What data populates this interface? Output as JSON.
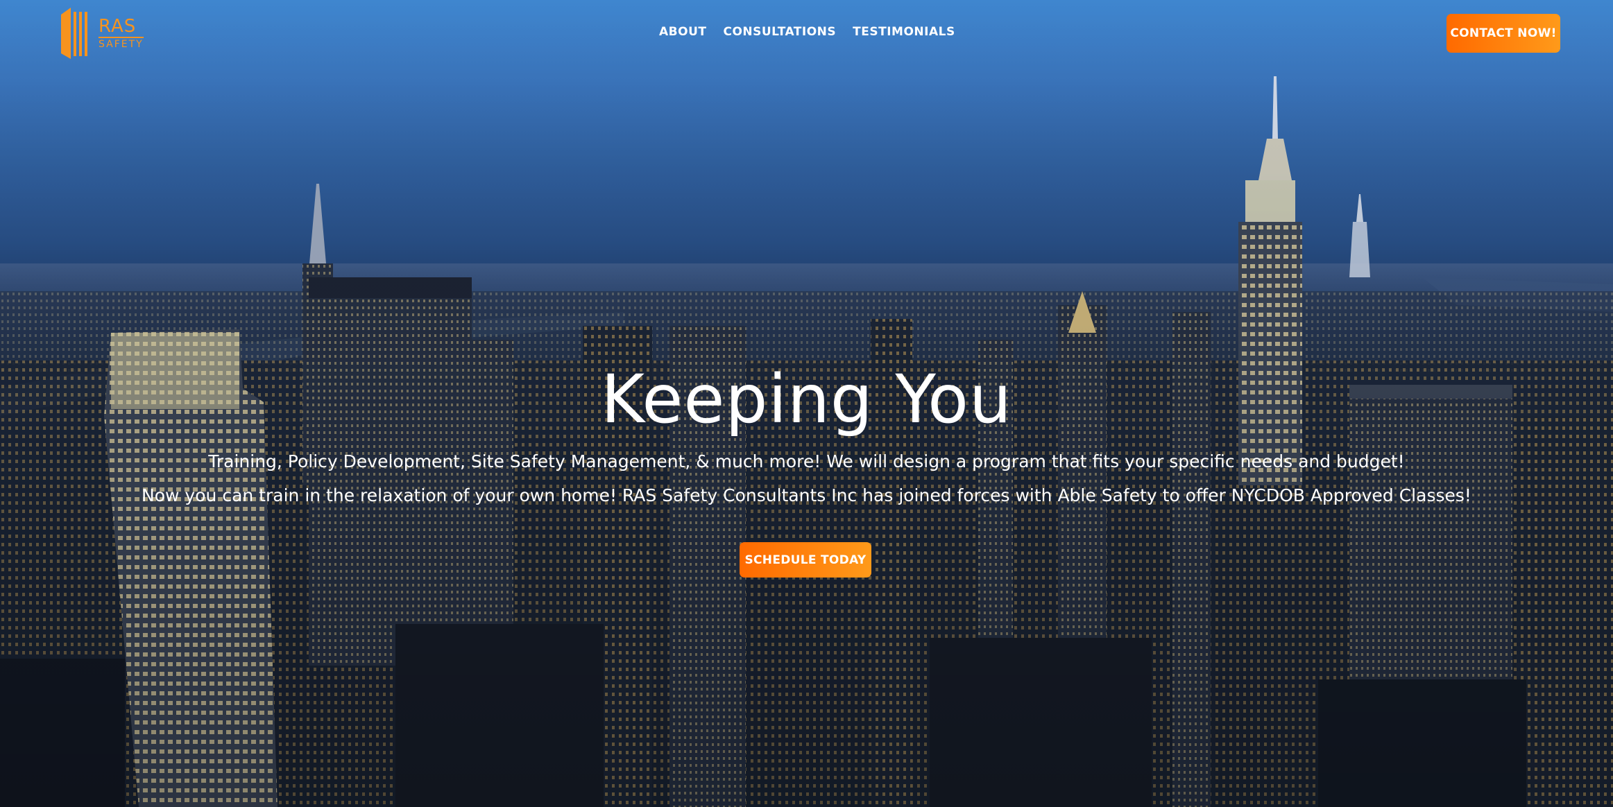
{
  "brand": {
    "logo_icon": "ras-safety-logo-icon",
    "name_top": "RAS",
    "name_bottom": "SAFETY",
    "accent_color": "#f7931e"
  },
  "nav": {
    "items": [
      {
        "label": "ABOUT"
      },
      {
        "label": "CONSULTATIONS"
      },
      {
        "label": "TESTIMONIALS"
      }
    ]
  },
  "header": {
    "cta_label": "CONTACT NOW!",
    "cta_color": "#ff7a00"
  },
  "hero": {
    "background": "city-skyline-at-dusk",
    "title": "Keeping You",
    "line1": "Training, Policy Development, Site Safety Management, & much more! We will design a program that fits your specific needs and budget!",
    "line2": "Now you can train in the relaxation of your own home! RAS Safety Consultants Inc has joined forces with Able Safety to offer NYCDOB Approved Classes!",
    "cta_label": "SCHEDULE TODAY"
  }
}
